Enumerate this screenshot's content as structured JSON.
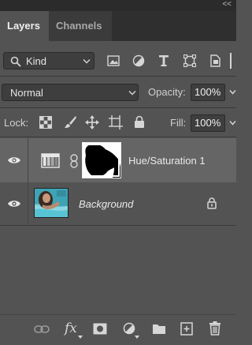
{
  "panel": {
    "collapse_glyph": "<<",
    "tabs": [
      {
        "label": "Layers",
        "active": true
      },
      {
        "label": "Channels",
        "active": false
      }
    ]
  },
  "filter": {
    "kind_label": "Kind",
    "icons": [
      "image-filter-icon",
      "adjustment-filter-icon",
      "type-filter-icon",
      "shape-filter-icon",
      "smart-object-filter-icon"
    ]
  },
  "blend": {
    "mode": "Normal",
    "opacity_label": "Opacity:",
    "opacity_value": "100%"
  },
  "lock": {
    "label": "Lock:",
    "fill_label": "Fill:",
    "fill_value": "100%"
  },
  "layers": [
    {
      "name": "Hue/Saturation 1",
      "type": "adjustment",
      "selected": true,
      "visible": true,
      "italic": false,
      "locked": false
    },
    {
      "name": "Background",
      "type": "image",
      "selected": false,
      "visible": true,
      "italic": true,
      "locked": true
    }
  ],
  "footer": {
    "fx_label": "fx",
    "icons": [
      "link-layers-icon",
      "layer-style-icon",
      "add-mask-icon",
      "new-fill-adjustment-icon",
      "new-group-icon",
      "new-layer-icon",
      "delete-layer-icon"
    ]
  },
  "colors": {
    "panel_bg": "#535353",
    "tab_bar": "#2f2f2f",
    "selected_row": "#656565",
    "field_bg": "#3e3e3e"
  }
}
